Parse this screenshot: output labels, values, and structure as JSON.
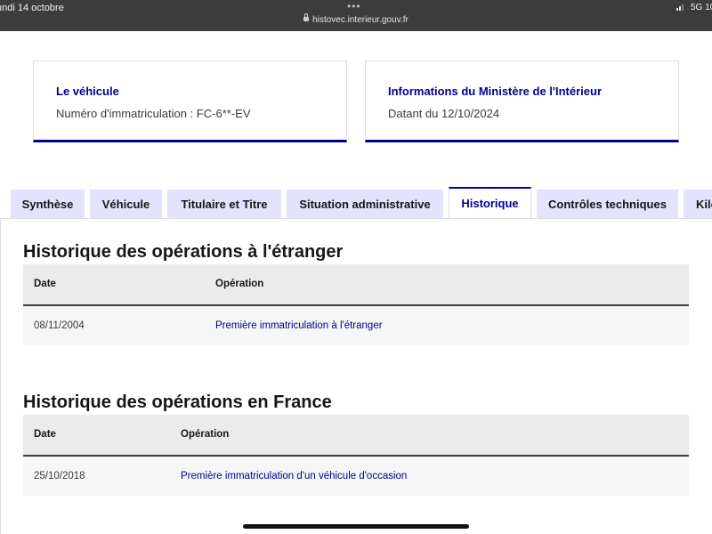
{
  "status_bar": {
    "time": "undi 14 octobre",
    "dots": "•••",
    "url": "histovec.interieur.gouv.fr",
    "network": "5G 10"
  },
  "cards": [
    {
      "title": "Le véhicule",
      "text": "Numéro d'immatriculation : FC-6**-EV"
    },
    {
      "title": "Informations du Ministère de l'Intérieur",
      "text": "Datant du 12/10/2024"
    }
  ],
  "tabs": [
    {
      "label": "Synthèse",
      "active": false
    },
    {
      "label": "Véhicule",
      "active": false
    },
    {
      "label": "Titulaire et Titre",
      "active": false
    },
    {
      "label": "Situation administrative",
      "active": false
    },
    {
      "label": "Historique",
      "active": true
    },
    {
      "label": "Contrôles techniques",
      "active": false
    },
    {
      "label": "Kilométrage",
      "active": false
    }
  ],
  "sections": {
    "foreign": {
      "title": "Historique des opérations à l'étranger",
      "columns": [
        "Date",
        "Opération"
      ],
      "rows": [
        {
          "date": "08/11/2004",
          "operation": "Première immatriculation à l'étranger"
        }
      ]
    },
    "france": {
      "title": "Historique des opérations en France",
      "columns": [
        "Date",
        "Opération"
      ],
      "rows": [
        {
          "date": "25/10/2018",
          "operation": "Première immatriculation d'un véhicule d'occasion"
        }
      ]
    }
  },
  "colors": {
    "accent": "#000091",
    "tab_background": "#e3e3fd",
    "table_header": "#ebebeb",
    "table_row": "#f6f6f6"
  }
}
